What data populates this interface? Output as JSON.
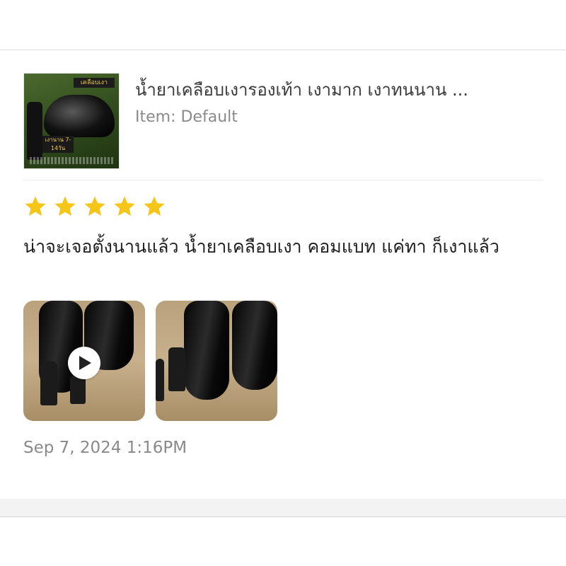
{
  "product": {
    "title": "น้ำยาเคลือบเงารองเท้า เงามาก เงาทนนาน ...",
    "variant": "Item: Default",
    "thumbnail": {
      "banner_text": "เคลือบเงา",
      "badge_text": "เงานาน 7-14วัน"
    }
  },
  "review": {
    "rating": 5,
    "rating_max": 5,
    "star_color": "#F5C518",
    "text": "น่าจะเจอตั้งนานแล้ว น้ำยาเคลือบเงา คอมแบท แค่ทา ก็เงาแล้ว",
    "media": [
      {
        "type": "video",
        "icon": "play-icon"
      },
      {
        "type": "image"
      }
    ],
    "timestamp": "Sep 7, 2024 1:16PM"
  }
}
